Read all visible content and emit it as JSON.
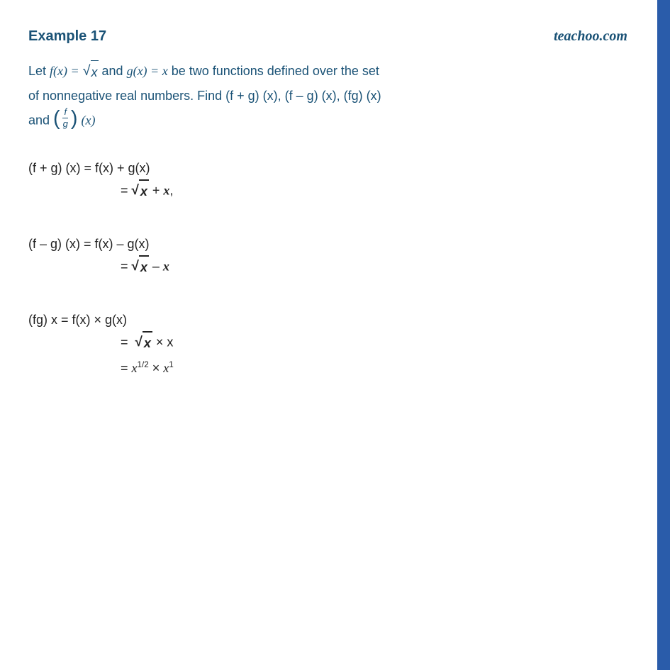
{
  "header": {
    "example_label": "Example 17",
    "brand": "teachoo.com"
  },
  "problem": {
    "text_parts": [
      "Let f(x) = √x and g(x) = x be two functions defined over the set",
      "of nonnegative real numbers. Find (f + g) (x), (f – g) (x), (fg) (x)",
      "and (f/g) (x)"
    ]
  },
  "solutions": {
    "part1": {
      "line1": "(f + g) (x) = f(x) + g(x)",
      "line2": "= √x + x,"
    },
    "part2": {
      "line1": "(f – g) (x) = f(x) – g(x)",
      "line2": "= √x – x"
    },
    "part3": {
      "line1": "(fg) x = f(x) × g(x)",
      "line2": "= √x × x",
      "line3": "= x^(1/2) × x^1"
    }
  }
}
